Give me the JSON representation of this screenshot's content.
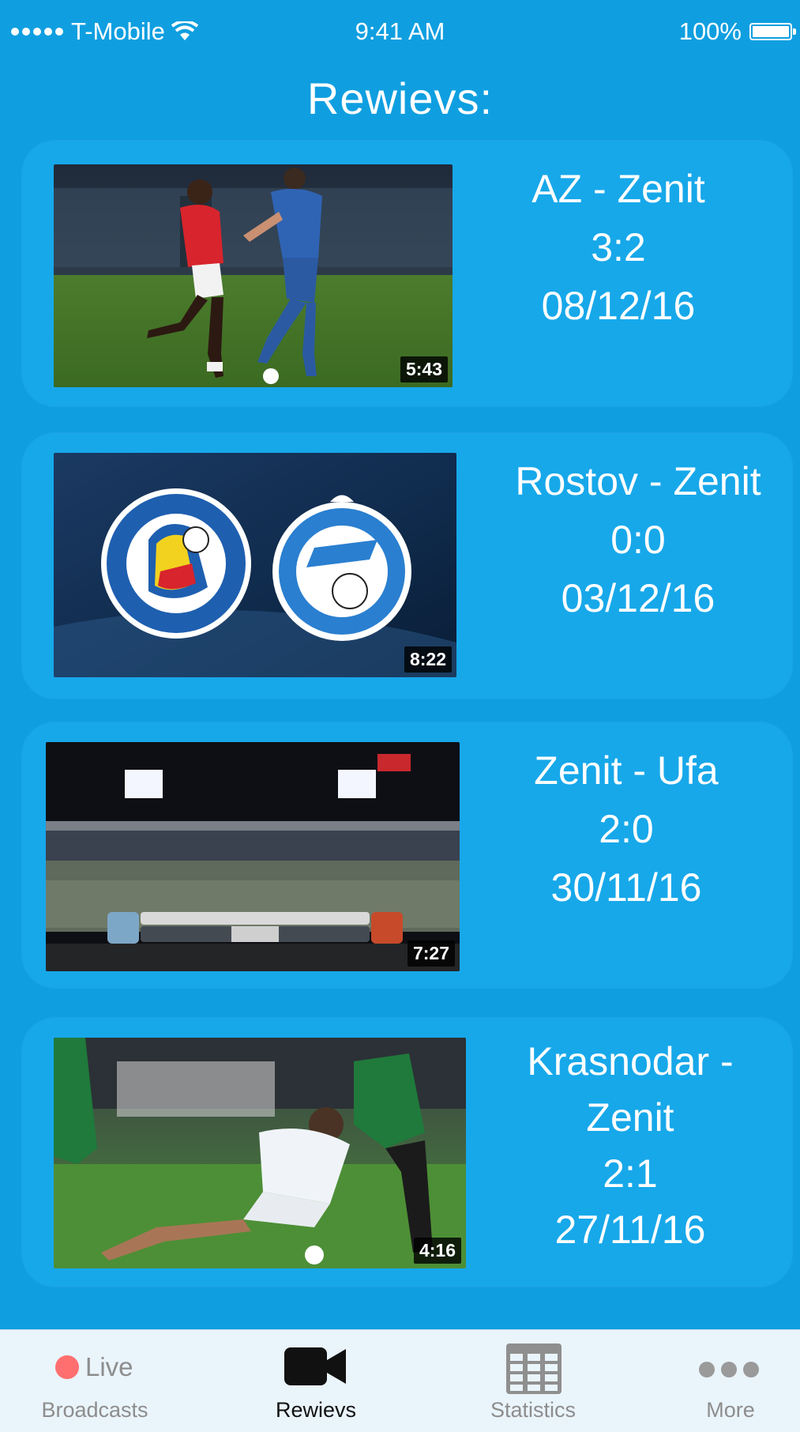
{
  "status_bar": {
    "carrier": "T-Mobile",
    "time": "9:41 AM",
    "battery": "100%"
  },
  "page": {
    "title": "Rewievs:"
  },
  "reviews": [
    {
      "teams": "AZ - Zenit",
      "score": "3:2",
      "date": "08/12/16",
      "duration": "5:43"
    },
    {
      "teams": "Rostov - Zenit",
      "score": "0:0",
      "date": "03/12/16",
      "duration": "8:22"
    },
    {
      "teams": "Zenit - Ufa",
      "score": "2:0",
      "date": "30/11/16",
      "duration": "7:27"
    },
    {
      "teams_line1": "Krasnodar -",
      "teams_line2": "Zenit",
      "score": "2:1",
      "date": "27/11/16",
      "duration": "4:16"
    }
  ],
  "tab_bar": {
    "tabs": [
      {
        "icon_label": "Live",
        "label": "Broadcasts",
        "icon": "live-dot-icon"
      },
      {
        "label": "Rewievs",
        "icon": "video-camera-icon",
        "active": true
      },
      {
        "label": "Statistics",
        "icon": "table-icon"
      },
      {
        "label": "More",
        "icon": "more-dots-icon"
      }
    ]
  },
  "colors": {
    "background": "#0f9fe0",
    "card": "#17a8ea",
    "tab_bar": "#eaf4fb",
    "live_dot": "#ff6f6f"
  }
}
